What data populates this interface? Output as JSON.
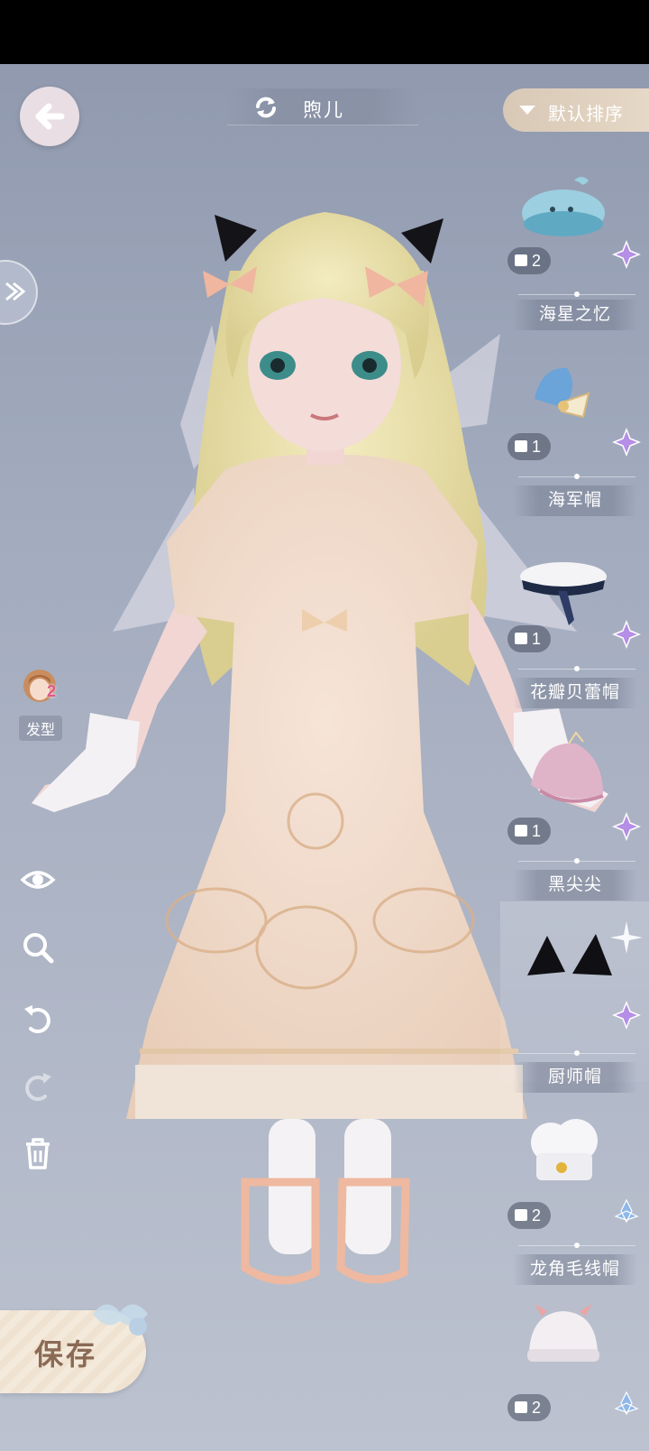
{
  "header": {
    "character_name": "煦儿",
    "sort_label": "默认排序"
  },
  "left_panel": {
    "hair_label": "发型",
    "hair_count": "2"
  },
  "save_label": "保存",
  "items": [
    {
      "name": "海星之忆",
      "count": "2",
      "rarity": "purple"
    },
    {
      "name": "海军帽",
      "count": "1",
      "rarity": "purple"
    },
    {
      "name": "花瓣贝蕾帽",
      "count": "1",
      "rarity": "purple"
    },
    {
      "name": "黑尖尖",
      "count": "1",
      "rarity": "purple"
    },
    {
      "name": "厨师帽",
      "count": "",
      "rarity": "purple"
    },
    {
      "name": "龙角毛线帽",
      "count": "2",
      "rarity": "blue"
    },
    {
      "name": "",
      "count": "2",
      "rarity": "blue"
    }
  ],
  "colors": {
    "rarity_purple": "#b58ee6",
    "rarity_blue": "#8fb8ea",
    "sort_bg": "#dfcfbd"
  }
}
